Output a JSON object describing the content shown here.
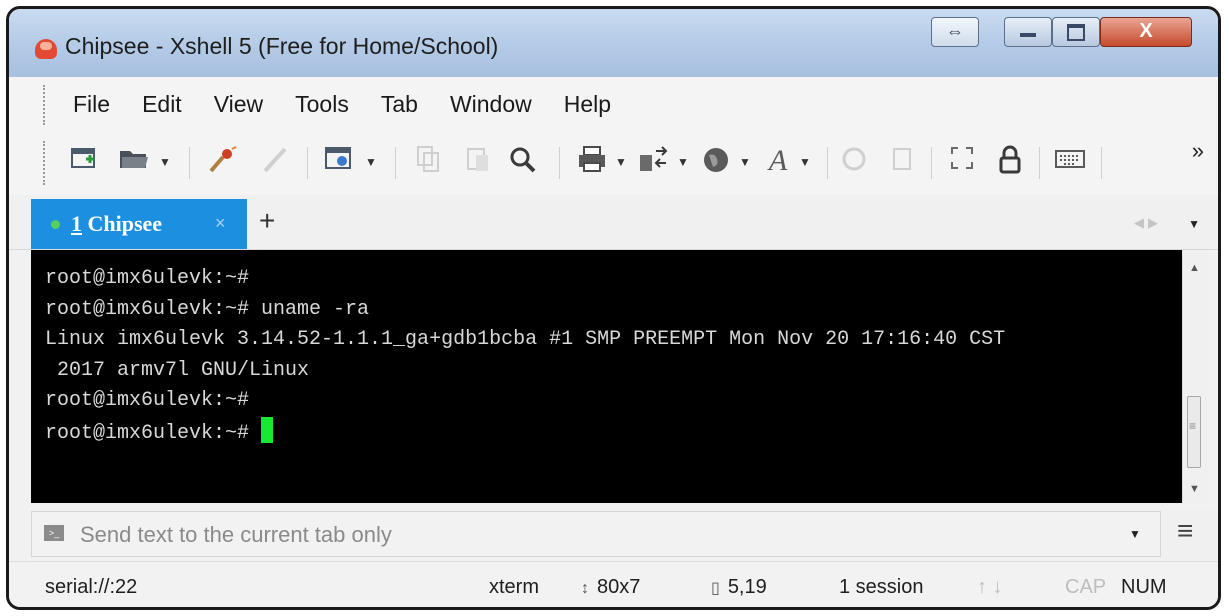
{
  "window": {
    "title": "Chipsee - Xshell 5 (Free for Home/School)",
    "controls": {
      "resize": "⇔",
      "close": "X"
    }
  },
  "menu": {
    "items": [
      "File",
      "Edit",
      "View",
      "Tools",
      "Tab",
      "Window",
      "Help"
    ]
  },
  "toolbar": {
    "more": "»"
  },
  "tabs": {
    "active": {
      "number": "1",
      "name": "Chipsee",
      "close": "×"
    },
    "add": "+"
  },
  "terminal": {
    "lines": [
      "root@imx6ulevk:~#",
      "root@imx6ulevk:~# uname -ra",
      "Linux imx6ulevk 3.14.52-1.1.1_ga+gdb1bcba #1 SMP PREEMPT Mon Nov 20 17:16:40 CST",
      " 2017 armv7l GNU/Linux",
      "root@imx6ulevk:~#",
      "root@imx6ulevk:~# "
    ],
    "cursor_color": "#19e832"
  },
  "compose": {
    "placeholder": "Send text to the current tab only"
  },
  "status": {
    "connection": "serial://:22",
    "terminal_type": "xterm",
    "size": "80x7",
    "cursor_pos": "5,19",
    "sessions": "1 session",
    "cap": "CAP",
    "num": "NUM"
  },
  "colors": {
    "tab_active": "#1d8fe1",
    "terminal_bg": "#000000",
    "terminal_fg": "#d8d8d8",
    "close_button": "#c74a2c"
  }
}
